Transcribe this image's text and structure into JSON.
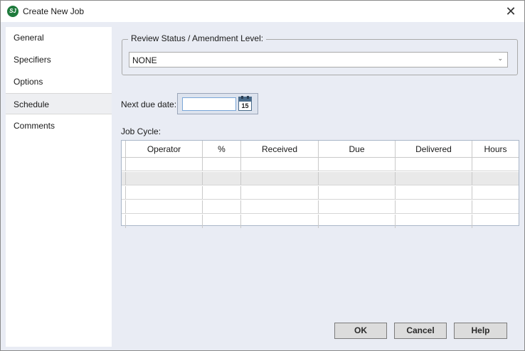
{
  "window": {
    "title": "Create New Job",
    "app_icon_text": "SJ",
    "close_glyph": "✕"
  },
  "nav": {
    "items": [
      {
        "label": "General",
        "active": false
      },
      {
        "label": "Specifiers",
        "active": false
      },
      {
        "label": "Options",
        "active": false
      },
      {
        "label": "Schedule",
        "active": true
      },
      {
        "label": "Comments",
        "active": false
      }
    ]
  },
  "review": {
    "group_label": "Review Status / Amendment Level:",
    "selected": "NONE",
    "arrow_icon": "chevron-down-icon"
  },
  "due": {
    "label": "Next due date:",
    "value": "",
    "calendar_day": "15"
  },
  "cycle": {
    "label": "Job Cycle:",
    "columns": [
      "Operator",
      "%",
      "Received",
      "Due",
      "Delivered",
      "Hours"
    ],
    "rows": [
      [
        "",
        "",
        "",
        "",
        "",
        ""
      ],
      [
        "",
        "",
        "",
        "",
        "",
        ""
      ],
      [
        "",
        "",
        "",
        "",
        "",
        ""
      ],
      [
        "",
        "",
        "",
        "",
        "",
        ""
      ],
      [
        "",
        "",
        "",
        "",
        "",
        ""
      ]
    ]
  },
  "buttons": {
    "ok": "OK",
    "cancel": "Cancel",
    "help": "Help"
  }
}
